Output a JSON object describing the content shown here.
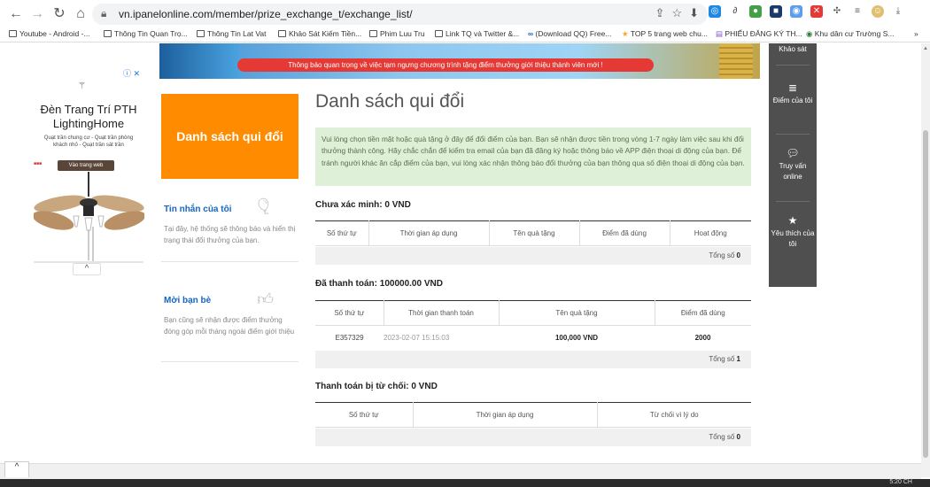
{
  "browser": {
    "url": "vn.ipanelonline.com/member/prize_exchange_t/exchange_list/",
    "bookmarks": [
      "Youtube - Android -...",
      "Thông Tin Quan Trọ...",
      "Thông Tin Lat Vat",
      "Khảo Sát Kiếm Tiền...",
      "Phim Luu Tru",
      "Link TQ và Twitter &...",
      "(Download QQ) Free...",
      "TOP 5 trang web chu...",
      "PHIẾU ĐĂNG KÝ TH...",
      "Khu dân cư Trường S..."
    ],
    "more": "»"
  },
  "ad": {
    "close": "ⓘ ✕",
    "title": "Đèn Trang Trí PTH LightingHome",
    "subtitle": "Quạt trần chung cư - Quạt trần phòng khách nhỏ - Quạt trần sát trần",
    "button": "Vào trang web",
    "collapse": "^"
  },
  "banner": {
    "text": "Thông báo quan trọng về việc tạm ngưng chương trình tặng điểm thưởng giới thiệu thành viên mới !"
  },
  "sidebar": {
    "heading": "Danh sách qui đổi",
    "messages_title": "Tin nhắn của tôi",
    "messages_text": "Tại đây, hệ thống sẽ thông báo và hiển thị trạng thái đổi thưởng của bạn.",
    "invite_title": "Mời bạn bè",
    "invite_text": "Bạn cũng sẽ nhận được điểm thưởng đóng góp mỗi tháng ngoài điểm giới thiệu"
  },
  "main": {
    "title": "Danh sách qui đổi",
    "notice": "Vui lòng chọn tiền mặt hoặc quà tặng ở đây để đổi điểm của bạn. Bạn sẽ nhận được tiền trong vòng 1-7 ngày làm việc sau khi đổi thưởng thành công. Hãy chắc chắn để kiểm tra email của bạn đã đăng ký hoặc thông báo về APP điện thoại di động của bạn. Để tránh người khác ăn cắp điểm của bạn, vui lòng xác nhận thông báo đổi thưởng của bạn thông qua số điện thoại di động của bạn.",
    "unconfirmed": {
      "title": "Chưa xác minh: 0 VND",
      "headers": [
        "Số thứ tự",
        "Thời gian áp dụng",
        "Tên quà tặng",
        "Điểm đã dùng",
        "Hoạt động"
      ],
      "total_label": "Tổng số",
      "total": "0"
    },
    "paid": {
      "title": "Đã thanh toán: 100000.00 VND",
      "headers": [
        "Số thứ tự",
        "Thời gian thanh toán",
        "Tên quà tặng",
        "Điểm đã dùng"
      ],
      "rows": [
        {
          "id": "E357329",
          "time": "2023-02-07 15:15:03",
          "gift": "100,000 VND",
          "points": "2000"
        }
      ],
      "total_label": "Tổng số",
      "total": "1"
    },
    "rejected": {
      "title": "Thanh toán bị từ chối: 0 VND",
      "headers": [
        "Số thứ tự",
        "Thời gian áp dụng",
        "Từ chối vì lý do"
      ],
      "total_label": "Tổng số",
      "total": "0"
    }
  },
  "right_panel": {
    "survey": "Khảo sát",
    "points": "Điểm của tôi",
    "online": "Truy vấn online",
    "favorites": "Yêu thích của tôi"
  },
  "taskbar": {
    "time": "5:20 CH"
  }
}
